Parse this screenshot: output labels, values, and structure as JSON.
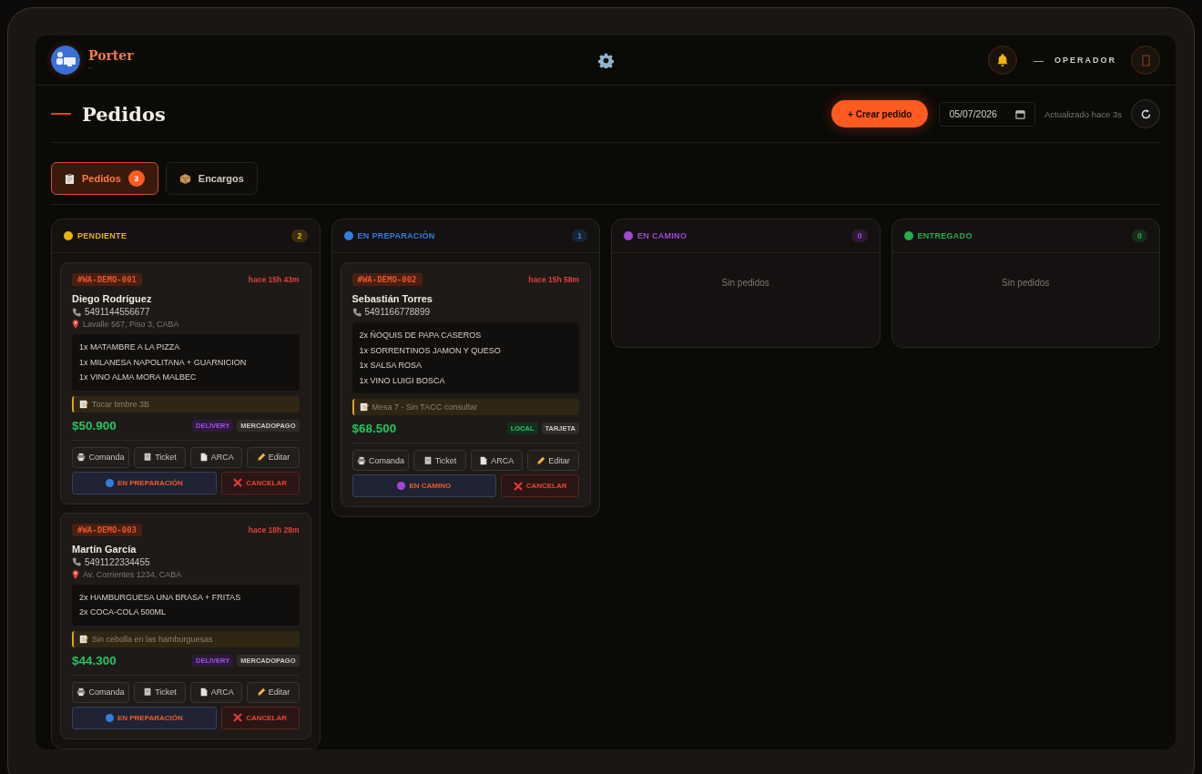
{
  "header": {
    "brand": "Porter",
    "brand_sub": "–",
    "user_dash": "—",
    "role": "OPERADOR"
  },
  "page": {
    "title": "Pedidos",
    "create_button": "+ Crear pedido",
    "date": "05/07/2026",
    "updated": "Actualizado hace 3s"
  },
  "tabs": [
    {
      "kind": "orders",
      "label": "Pedidos",
      "count": "3",
      "selected": true
    },
    {
      "kind": "parcels",
      "label": "Encargos",
      "selected": false
    }
  ],
  "columns": [
    {
      "title": "PENDIENTE",
      "color": "#eab308",
      "count": "2",
      "orders": [
        {
          "id": "#WA-DEMO-001",
          "age": "hace 15h 43m",
          "name": "Diego Rodríguez",
          "phone": "5491144556677",
          "address": "Lavalle 567, Piso 3, CABA",
          "items": [
            "1x MATAMBRE A LA PIZZA",
            "1x MILANESA NAPOLITANA + GUARNICION",
            "1x VINO ALMA MORA MALBEC"
          ],
          "note": "Tocar timbre 3B",
          "total": "$50.900",
          "tags": [
            {
              "kind": "delivery",
              "label": "DELIVERY"
            },
            {
              "kind": "payment",
              "label": "MERCADOPAGO"
            }
          ],
          "actions": [
            {
              "kind": "print",
              "label": "Comanda"
            },
            {
              "kind": "receipt",
              "label": "Ticket"
            },
            {
              "kind": "doc",
              "label": "ARCA"
            },
            {
              "kind": "edit",
              "label": "Editar"
            }
          ],
          "advance": {
            "label": "EN PREPARACIÓN",
            "color": "#2f7fe0"
          },
          "cancel": "CANCELAR"
        },
        {
          "id": "#WA-DEMO-003",
          "age": "hace 18h 28m",
          "name": "Martín García",
          "phone": "5491122334455",
          "address": "Av. Corrientes 1234, CABA",
          "items": [
            "2x HAMBURGUESA UNA BRASA + FRITAS",
            "2x COCA-COLA 500ML"
          ],
          "note": "Sin cebolla en las hamburguesas",
          "total": "$44.300",
          "tags": [
            {
              "kind": "delivery",
              "label": "DELIVERY"
            },
            {
              "kind": "payment",
              "label": "MERCADOPAGO"
            }
          ],
          "actions": [
            {
              "kind": "print",
              "label": "Comanda"
            },
            {
              "kind": "receipt",
              "label": "Ticket"
            },
            {
              "kind": "doc",
              "label": "ARCA"
            },
            {
              "kind": "edit",
              "label": "Editar"
            }
          ],
          "advance": {
            "label": "EN PREPARACIÓN",
            "color": "#2f7fe0"
          },
          "cancel": "CANCELAR"
        }
      ]
    },
    {
      "title": "EN PREPARACIÓN",
      "color": "#2f7fe0",
      "count": "1",
      "orders": [
        {
          "id": "#WA-DEMO-002",
          "age": "hace 15h 58m",
          "name": "Sebastián Torres",
          "phone": "5491166778899",
          "items": [
            "2x ÑOQUIS DE PAPA CASEROS",
            "1x SORRENTINOS JAMON Y QUESO",
            "1x SALSA ROSA",
            "1x VINO LUIGI BOSCA"
          ],
          "note": "Mesa 7 - Sin TACC consultar",
          "total": "$68.500",
          "tags": [
            {
              "kind": "local",
              "label": "LOCAL"
            },
            {
              "kind": "payment",
              "label": "TARJETA"
            }
          ],
          "actions": [
            {
              "kind": "print",
              "label": "Comanda"
            },
            {
              "kind": "receipt",
              "label": "Ticket"
            },
            {
              "kind": "doc",
              "label": "ARCA"
            },
            {
              "kind": "edit",
              "label": "Editar"
            }
          ],
          "advance": {
            "label": "EN CAMINO",
            "color": "#a445d8"
          },
          "cancel": "CANCELAR"
        }
      ]
    },
    {
      "title": "EN CAMINO",
      "color": "#a445d8",
      "count": "0",
      "empty_text": "Sin pedidos"
    },
    {
      "title": "ENTREGADO",
      "color": "#22b04b",
      "count": "0",
      "empty_text": "Sin pedidos"
    }
  ]
}
